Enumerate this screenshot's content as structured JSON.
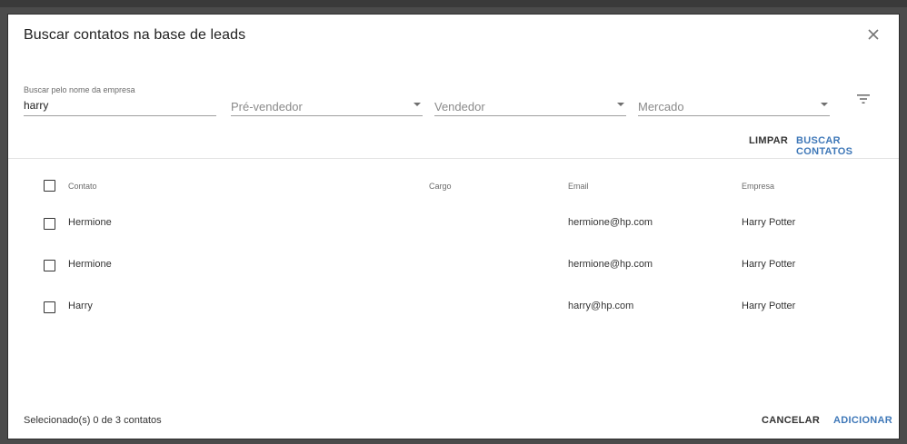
{
  "dialog": {
    "title": "Buscar contatos na base de leads"
  },
  "filters": {
    "company": {
      "label": "Buscar pelo nome da empresa",
      "value": "harry"
    },
    "presales": {
      "placeholder": "Pré-vendedor"
    },
    "seller": {
      "placeholder": "Vendedor"
    },
    "market": {
      "placeholder": "Mercado"
    }
  },
  "actions": {
    "clear_label": "LIMPAR",
    "search_label": "BUSCAR CONTATOS"
  },
  "table": {
    "columns": [
      "Contato",
      "Cargo",
      "Email",
      "Empresa"
    ],
    "rows": [
      {
        "contato": "Hermione",
        "cargo": "",
        "email": "hermione@hp.com",
        "empresa": "Harry Potter"
      },
      {
        "contato": "Hermione",
        "cargo": "",
        "email": "hermione@hp.com",
        "empresa": "Harry Potter"
      },
      {
        "contato": "Harry",
        "cargo": "",
        "email": "harry@hp.com",
        "empresa": "Harry Potter"
      }
    ]
  },
  "footer": {
    "selection_text": "Selecionado(s) 0 de 3 contatos",
    "cancel_label": "CANCELAR",
    "add_label": "ADICIONAR"
  },
  "colors": {
    "accent": "#3f78b8",
    "backdrop": "#4b4b4b"
  },
  "icons": {
    "close": "close-icon",
    "filter": "filter-list-icon",
    "dropdown": "chevron-down-icon"
  }
}
